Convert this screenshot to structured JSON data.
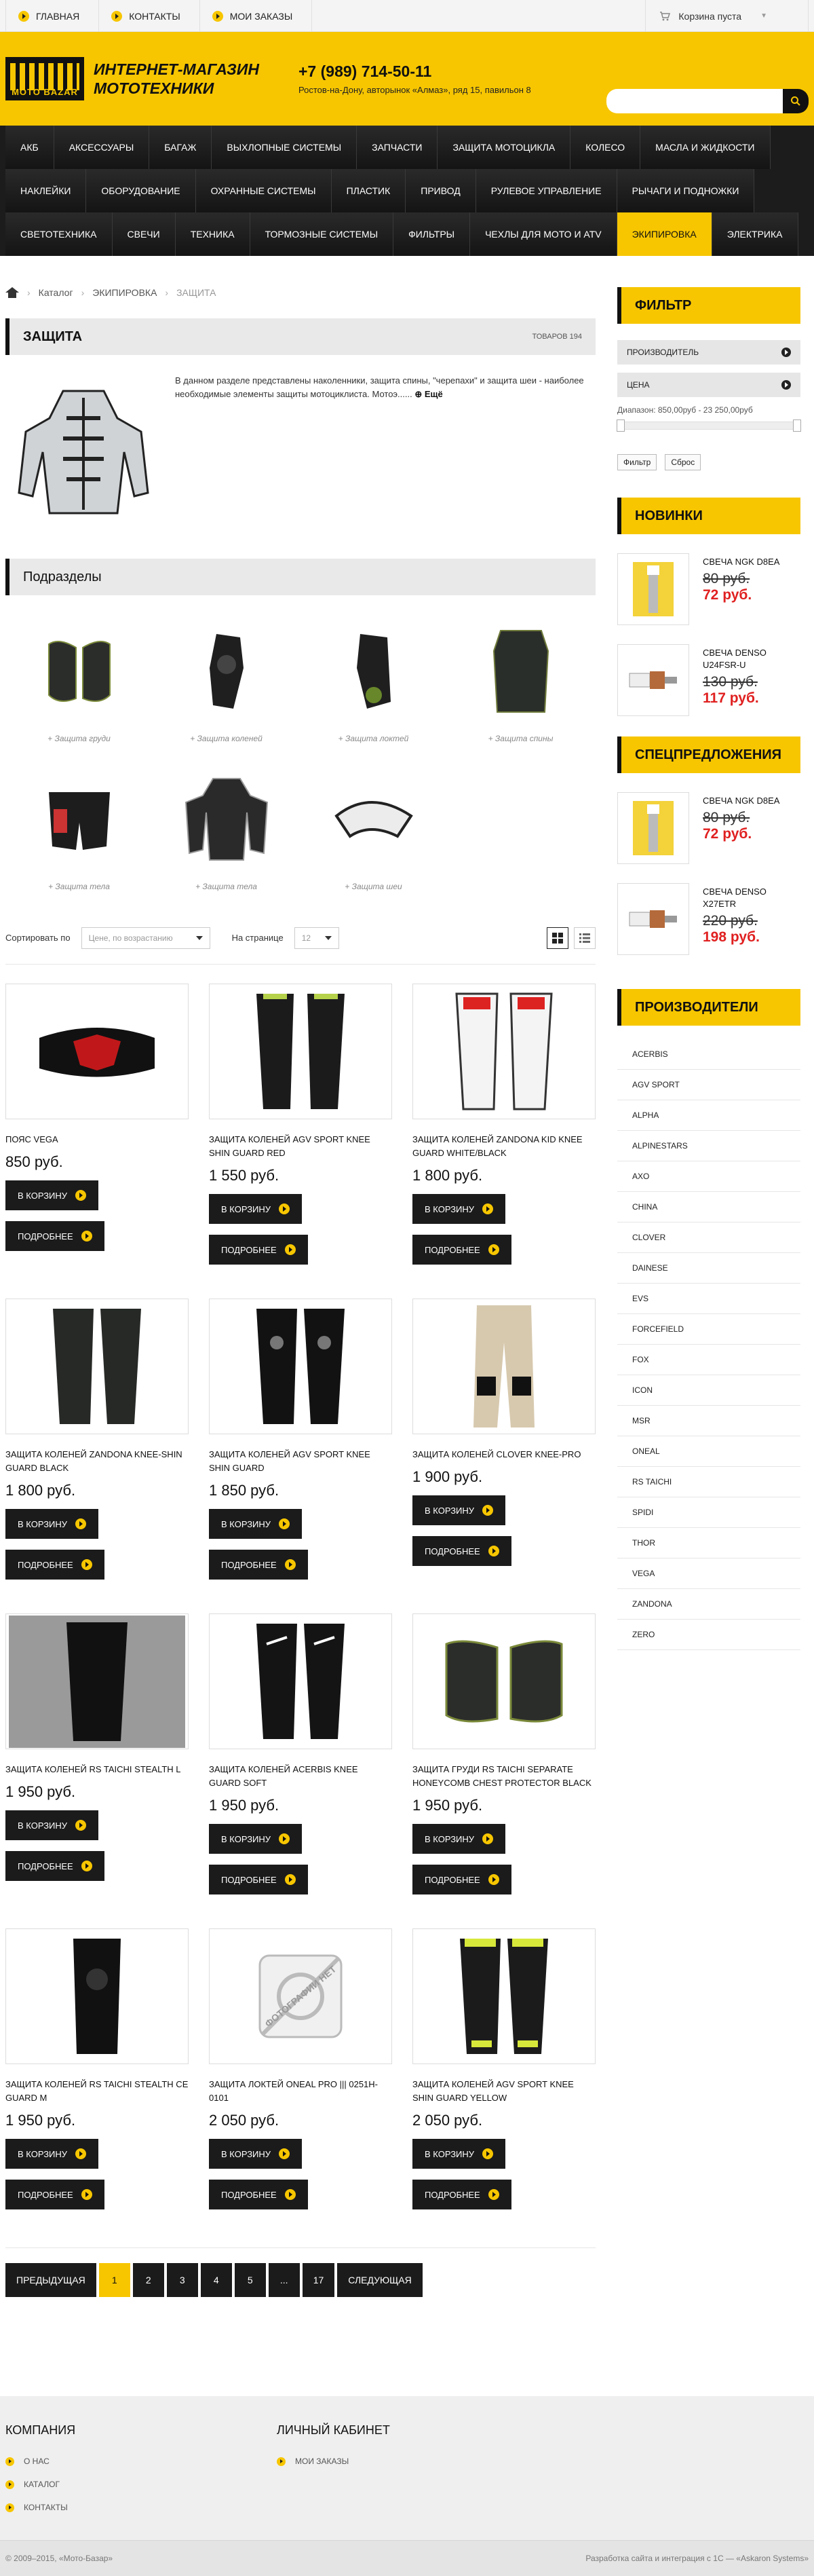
{
  "topbar": {
    "links": [
      "ГЛАВНАЯ",
      "КОНТАКТЫ",
      "МОИ ЗАКАЗЫ"
    ],
    "cart_label": "Корзина пуста"
  },
  "header": {
    "logo_text": "MOTO BAZAR",
    "shop_name": "ИНТЕРНЕТ-МАГАЗИН МОТОТЕХНИКИ",
    "phone": "+7 (989) 714-50-11",
    "address": "Ростов-на-Дону, авторынок «Алмаз», ряд 15, павильон 8",
    "search_placeholder": ""
  },
  "menu": [
    "АКБ",
    "АКСЕССУАРЫ",
    "БАГАЖ",
    "ВЫХЛОПНЫЕ СИСТЕМЫ",
    "ЗАПЧАСТИ",
    "ЗАЩИТА МОТОЦИКЛА",
    "КОЛЕСО",
    "МАСЛА И ЖИДКОСТИ",
    "НАКЛЕЙКИ",
    "ОБОРУДОВАНИЕ",
    "ОХРАННЫЕ СИСТЕМЫ",
    "ПЛАСТИК",
    "ПРИВОД",
    "РУЛЕВОЕ УПРАВЛЕНИЕ",
    "РЫЧАГИ И ПОДНОЖКИ",
    "СВЕТОТЕХНИКА",
    "СВЕЧИ",
    "ТЕХНИКА",
    "ТОРМОЗНЫЕ СИСТЕМЫ",
    "ФИЛЬТРЫ",
    "ЧЕХЛЫ ДЛЯ МОТО И ATV",
    "ЭКИПИРОВКА",
    "ЭЛЕКТРИКА"
  ],
  "menu_active": "ЭКИПИРОВКА",
  "breadcrumb": {
    "catalog": "Каталог",
    "section": "ЭКИПИРОВКА",
    "current": "ЗАЩИТА"
  },
  "section": {
    "title": "ЗАЩИТА",
    "count": "ТОВАРОВ 194",
    "intro": "В данном разделе представлены наколенники, защита спины, \"черепахи\" и защита шеи - наиболее необходимые элементы защиты мотоциклиста. Мотоэ......",
    "more": "Ещё"
  },
  "subsections": {
    "title": "Подразделы",
    "items": [
      "+ Защита груди",
      "+ Защита коленей",
      "+ Защита локтей",
      "+ Защита спины",
      "+ Защита тела",
      "+ Защита тела",
      "+ Защита шеи"
    ]
  },
  "sorting": {
    "sort_label": "Сортировать по",
    "sort_value": "Цене, по возрастанию",
    "per_page_label": "На странице",
    "per_page_value": "12"
  },
  "buttons": {
    "cart": "В КОРЗИНУ",
    "more": "ПОДРОБНЕЕ"
  },
  "products": [
    {
      "name": "ПОЯС VEGA",
      "price": "850 руб."
    },
    {
      "name": "ЗАЩИТА КОЛЕНЕЙ AGV SPORT KNEE SHIN GUARD RED",
      "price": "1 550 руб."
    },
    {
      "name": "ЗАЩИТА КОЛЕНЕЙ ZANDONA KID KNEE GUARD WHITE/BLACK",
      "price": "1 800 руб."
    },
    {
      "name": "ЗАЩИТА КОЛЕНЕЙ ZANDONA KNEE-SHIN GUARD BLACK",
      "price": "1 800 руб."
    },
    {
      "name": "ЗАЩИТА КОЛЕНЕЙ AGV SPORT KNEE SHIN GUARD",
      "price": "1 850 руб."
    },
    {
      "name": "ЗАЩИТА КОЛЕНЕЙ CLOVER KNEE-PRO",
      "price": "1 900 руб."
    },
    {
      "name": "ЗАЩИТА КОЛЕНЕЙ RS TAICHI STEALTH L",
      "price": "1 950 руб."
    },
    {
      "name": "ЗАЩИТА КОЛЕНЕЙ ACERBIS KNEE GUARD SOFT",
      "price": "1 950 руб."
    },
    {
      "name": "ЗАЩИТА ГРУДИ RS TAICHI SEPARATE HONEYCOMB CHEST PROTECTOR BLACK",
      "price": "1 950 руб."
    },
    {
      "name": "ЗАЩИТА КОЛЕНЕЙ RS TAICHI STEALTH CE GUARD M",
      "price": "1 950 руб."
    },
    {
      "name": "ЗАЩИТА ЛОКТЕЙ ONEAL PRO ||| 0251H-0101",
      "price": "2 050 руб."
    },
    {
      "name": "ЗАЩИТА КОЛЕНЕЙ AGV SPORT KNEE SHIN GUARD YELLOW",
      "price": "2 050 руб."
    }
  ],
  "no_photo_text": "ФОТОГРАФИИ НЕТ",
  "pagination": [
    "ПРЕДЫДУЩАЯ",
    "1",
    "2",
    "3",
    "4",
    "5",
    "...",
    "17",
    "СЛЕДУЮЩАЯ"
  ],
  "filter": {
    "title": "ФИЛЬТР",
    "rows": [
      "ПРОИЗВОДИТЕЛЬ",
      "ЦЕНА"
    ],
    "range": "Диапазон: 850,00руб - 23 250,00руб",
    "apply": "Фильтр",
    "reset": "Сброс"
  },
  "novelties": {
    "title": "НОВИНКИ",
    "items": [
      {
        "name": "СВЕЧА NGK D8EA",
        "old": "80 руб.",
        "new": "72 руб."
      },
      {
        "name": "СВЕЧА DENSO U24FSR-U",
        "old": "130 руб.",
        "new": "117 руб."
      }
    ]
  },
  "specials": {
    "title": "СПЕЦПРЕДЛОЖЕНИЯ",
    "items": [
      {
        "name": "СВЕЧА NGK D8EA",
        "old": "80 руб.",
        "new": "72 руб."
      },
      {
        "name": "СВЕЧА DENSO X27ETR",
        "old": "220 руб.",
        "new": "198 руб."
      }
    ]
  },
  "brands": {
    "title": "ПРОИЗВОДИТЕЛИ",
    "items": [
      "ACERBIS",
      "AGV SPORT",
      "ALPHA",
      "ALPINESTARS",
      "AXO",
      "CHINA",
      "CLOVER",
      "DAINESE",
      "EVS",
      "FORCEFIELD",
      "FOX",
      "ICON",
      "MSR",
      "ONEAL",
      "RS TAICHI",
      "SPIDI",
      "THOR",
      "VEGA",
      "ZANDONA",
      "ZERO"
    ]
  },
  "footer": {
    "company_title": "КОМПАНИЯ",
    "company_links": [
      "О НАС",
      "КАТАЛОГ",
      "КОНТАКТЫ"
    ],
    "account_title": "ЛИЧНЫЙ КАБИНЕТ",
    "account_links": [
      "МОИ ЗАКАЗЫ"
    ],
    "copyright": "© 2009–2015, «Мото-Базар»",
    "dev": "Разработка сайта и интеграция с 1С — «Askaron Systems»"
  },
  "colors": {
    "accent": "#f7c600",
    "dark": "#1b1b1b",
    "price_red": "#e02020"
  }
}
